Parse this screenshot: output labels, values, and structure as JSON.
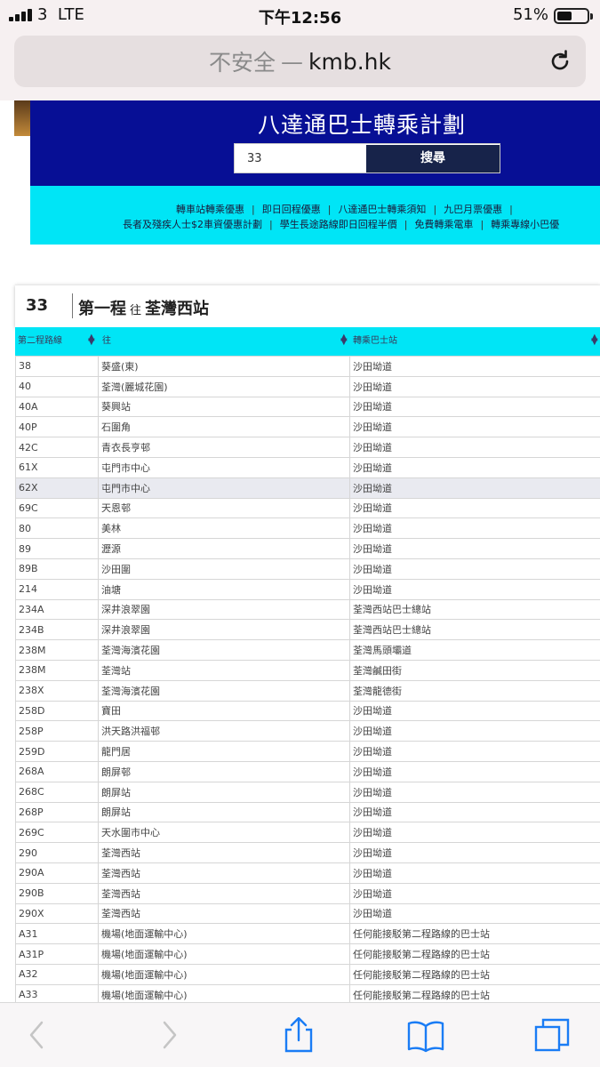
{
  "status": {
    "carrier": "3",
    "network": "LTE",
    "time": "下午12:56",
    "battery": "51%",
    "battery_level": 0.51
  },
  "address_bar": {
    "security": "不安全",
    "dash": "—",
    "domain": "kmb.hk"
  },
  "banner": {
    "title": "八達通巴士轉乘計劃",
    "search_value": "33",
    "search_button": "搜尋",
    "background_color": "#070f95"
  },
  "links": {
    "row1": [
      "轉車站轉乘優惠",
      "即日回程優惠",
      "八達通巴士轉乘須知",
      "九巴月票優惠"
    ],
    "row2": [
      "長者及殘疾人士$2車資優惠計劃",
      "學生長途路線即日回程半價",
      "免費轉乘電車",
      "轉乘專線小巴優"
    ],
    "separator": "|",
    "background_color": "#00e5f6"
  },
  "route_card": {
    "route": "33",
    "leg": "第一程",
    "direction": "往",
    "destination": "荃灣西站"
  },
  "table": {
    "headers": [
      "第二程路線",
      "往",
      "轉乘巴士站"
    ],
    "rows": [
      [
        "38",
        "葵盛(東)",
        "沙田坳道"
      ],
      [
        "40",
        "荃灣(麗城花園)",
        "沙田坳道"
      ],
      [
        "40A",
        "葵興站",
        "沙田坳道"
      ],
      [
        "40P",
        "石圍角",
        "沙田坳道"
      ],
      [
        "42C",
        "青衣長亨邨",
        "沙田坳道"
      ],
      [
        "61X",
        "屯門市中心",
        "沙田坳道"
      ],
      [
        "62X",
        "屯門市中心",
        "沙田坳道"
      ],
      [
        "69C",
        "天恩邨",
        "沙田坳道"
      ],
      [
        "80",
        "美林",
        "沙田坳道"
      ],
      [
        "89",
        "瀝源",
        "沙田坳道"
      ],
      [
        "89B",
        "沙田圍",
        "沙田坳道"
      ],
      [
        "214",
        "油塘",
        "沙田坳道"
      ],
      [
        "234A",
        "深井浪翠園",
        "荃灣西站巴士總站"
      ],
      [
        "234B",
        "深井浪翠園",
        "荃灣西站巴士總站"
      ],
      [
        "238M",
        "荃灣海濱花園",
        "荃灣馬頭壩道"
      ],
      [
        "238M",
        "荃灣站",
        "荃灣鹹田街"
      ],
      [
        "238X",
        "荃灣海濱花園",
        "荃灣龍德街"
      ],
      [
        "258D",
        "寶田",
        "沙田坳道"
      ],
      [
        "258P",
        "洪天路洪福邨",
        "沙田坳道"
      ],
      [
        "259D",
        "龍門居",
        "沙田坳道"
      ],
      [
        "268A",
        "朗屏邨",
        "沙田坳道"
      ],
      [
        "268C",
        "朗屏站",
        "沙田坳道"
      ],
      [
        "268P",
        "朗屏站",
        "沙田坳道"
      ],
      [
        "269C",
        "天水圍市中心",
        "沙田坳道"
      ],
      [
        "290",
        "荃灣西站",
        "沙田坳道"
      ],
      [
        "290A",
        "荃灣西站",
        "沙田坳道"
      ],
      [
        "290B",
        "荃灣西站",
        "沙田坳道"
      ],
      [
        "290X",
        "荃灣西站",
        "沙田坳道"
      ],
      [
        "A31",
        "機場(地面運輸中心)",
        "任何能接駁第二程路線的巴士站"
      ],
      [
        "A31P",
        "機場(地面運輸中心)",
        "任何能接駁第二程路線的巴士站"
      ],
      [
        "A32",
        "機場(地面運輸中心)",
        "任何能接駁第二程路線的巴士站"
      ],
      [
        "A33",
        "機場(地面運輸中心)",
        "任何能接駁第二程路線的巴士站"
      ]
    ],
    "highlighted_row": 6,
    "header_color": "#00e5f6"
  },
  "toolbar": {
    "icons": [
      "back-icon",
      "forward-icon",
      "share-icon",
      "bookmarks-icon",
      "tabs-icon"
    ],
    "tint": "#1a7cf5"
  }
}
